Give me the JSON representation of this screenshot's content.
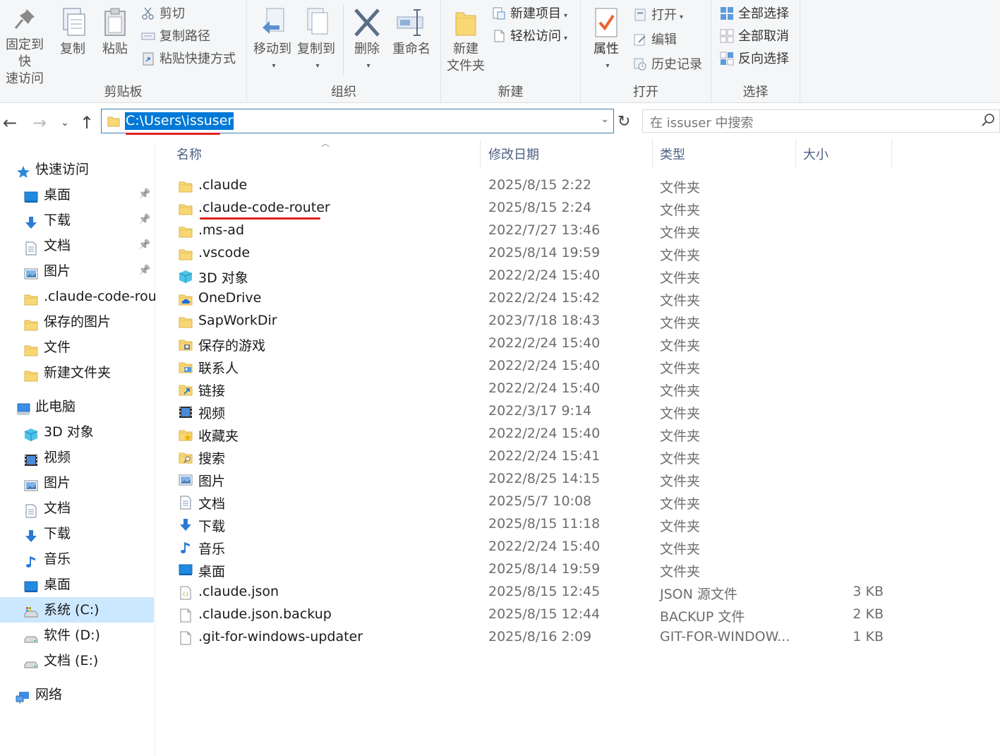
{
  "ribbon": {
    "clipboard": {
      "label": "剪贴板",
      "pin_line1": "固定到快",
      "pin_line2": "速访问",
      "copy": "复制",
      "paste": "粘贴",
      "cut": "剪切",
      "copy_path": "复制路径",
      "paste_shortcut": "粘贴快捷方式"
    },
    "organize": {
      "label": "组织",
      "move_to": "移动到",
      "copy_to": "复制到",
      "delete": "删除",
      "rename": "重命名"
    },
    "new": {
      "label": "新建",
      "new_folder_line1": "新建",
      "new_folder_line2": "文件夹",
      "new_item": "新建项目",
      "easy_access": "轻松访问"
    },
    "open": {
      "label": "打开",
      "properties": "属性",
      "open": "打开",
      "edit": "编辑",
      "history": "历史记录"
    },
    "select": {
      "label": "选择",
      "select_all": "全部选择",
      "select_none": "全部取消",
      "invert": "反向选择"
    }
  },
  "address": {
    "path": "C:\\Users\\issuser"
  },
  "search": {
    "placeholder": "在 issuser 中搜索"
  },
  "columns": {
    "name": "名称",
    "date": "修改日期",
    "type": "类型",
    "size": "大小"
  },
  "navpane": {
    "quick_access": "快速访问",
    "quick_items": [
      "桌面",
      "下载",
      "文档",
      "图片",
      ".claude-code-router",
      "保存的图片",
      "文件",
      "新建文件夹"
    ],
    "this_pc": "此电脑",
    "pc_items": [
      "3D 对象",
      "视频",
      "图片",
      "文档",
      "下载",
      "音乐",
      "桌面",
      "系统 (C:)",
      "软件 (D:)",
      "文档 (E:)"
    ],
    "network": "网络"
  },
  "files": [
    {
      "name": ".claude",
      "date": "2025/8/15 2:22",
      "type": "文件夹",
      "size": "",
      "icon": "folder-icon"
    },
    {
      "name": ".claude-code-router",
      "date": "2025/8/15 2:24",
      "type": "文件夹",
      "size": "",
      "icon": "folder-icon"
    },
    {
      "name": ".ms-ad",
      "date": "2022/7/27 13:46",
      "type": "文件夹",
      "size": "",
      "icon": "folder-icon"
    },
    {
      "name": ".vscode",
      "date": "2025/8/14 19:59",
      "type": "文件夹",
      "size": "",
      "icon": "folder-icon"
    },
    {
      "name": "3D 对象",
      "date": "2022/2/24 15:40",
      "type": "文件夹",
      "size": "",
      "icon": "3d-objects-icon"
    },
    {
      "name": "OneDrive",
      "date": "2022/2/24 15:42",
      "type": "文件夹",
      "size": "",
      "icon": "onedrive-icon"
    },
    {
      "name": "SapWorkDir",
      "date": "2023/7/18 18:43",
      "type": "文件夹",
      "size": "",
      "icon": "folder-icon"
    },
    {
      "name": "保存的游戏",
      "date": "2022/2/24 15:40",
      "type": "文件夹",
      "size": "",
      "icon": "saved-games-icon"
    },
    {
      "name": "联系人",
      "date": "2022/2/24 15:40",
      "type": "文件夹",
      "size": "",
      "icon": "contacts-icon"
    },
    {
      "name": "链接",
      "date": "2022/2/24 15:40",
      "type": "文件夹",
      "size": "",
      "icon": "links-icon"
    },
    {
      "name": "视频",
      "date": "2022/3/17 9:14",
      "type": "文件夹",
      "size": "",
      "icon": "videos-icon"
    },
    {
      "name": "收藏夹",
      "date": "2022/2/24 15:40",
      "type": "文件夹",
      "size": "",
      "icon": "favorites-icon"
    },
    {
      "name": "搜索",
      "date": "2022/2/24 15:41",
      "type": "文件夹",
      "size": "",
      "icon": "searches-icon"
    },
    {
      "name": "图片",
      "date": "2022/8/25 14:15",
      "type": "文件夹",
      "size": "",
      "icon": "pictures-icon"
    },
    {
      "name": "文档",
      "date": "2025/5/7 10:08",
      "type": "文件夹",
      "size": "",
      "icon": "documents-icon"
    },
    {
      "name": "下载",
      "date": "2025/8/15 11:18",
      "type": "文件夹",
      "size": "",
      "icon": "downloads-icon"
    },
    {
      "name": "音乐",
      "date": "2022/2/24 15:40",
      "type": "文件夹",
      "size": "",
      "icon": "music-icon"
    },
    {
      "name": "桌面",
      "date": "2025/8/14 19:59",
      "type": "文件夹",
      "size": "",
      "icon": "desktop-icon"
    },
    {
      "name": ".claude.json",
      "date": "2025/8/15 12:45",
      "type": "JSON 源文件",
      "size": "3 KB",
      "icon": "json-file-icon"
    },
    {
      "name": ".claude.json.backup",
      "date": "2025/8/15 12:44",
      "type": "BACKUP 文件",
      "size": "2 KB",
      "icon": "file-icon"
    },
    {
      "name": ".git-for-windows-updater",
      "date": "2025/8/16 2:09",
      "type": "GIT-FOR-WINDOW...",
      "size": "1 KB",
      "icon": "file-icon"
    }
  ],
  "colors": {
    "accent": "#0078d7",
    "folder": "#f8d775",
    "annotation": "#e02020"
  }
}
